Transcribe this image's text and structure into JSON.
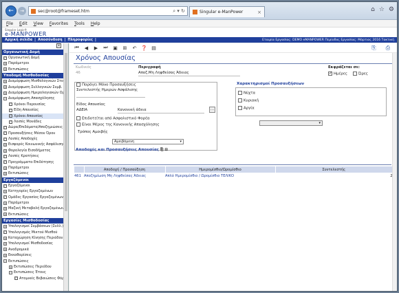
{
  "browser": {
    "address": "sec@root@frameset.htm",
    "tab_title": "Singular e-ManPower"
  },
  "menu": [
    "File",
    "Edit",
    "View",
    "Favorites",
    "Tools",
    "Help"
  ],
  "app": {
    "logo_top": "Singular Logic®",
    "logo": "e-MANPOWER",
    "nav_left": [
      "Αρχική σελίδα",
      "Αποσύνδεση",
      "Πληροφορίες"
    ],
    "nav_right": "Εταιρία Εργασίας: DEMO eMANPOWER   Περίοδος Εργασίας: Μάρτιος 2016 Τακτική"
  },
  "sidebar": {
    "sections": [
      {
        "title": "Οργανωτική Δομή",
        "items": [
          {
            "label": "Οργανωτική Δομή",
            "lvl": 0,
            "bx": "□"
          },
          {
            "label": "Παράμετροι",
            "lvl": 0,
            "bx": "+"
          },
          {
            "label": "Εκτυπώσεις",
            "lvl": 0,
            "bx": "+"
          }
        ]
      },
      {
        "title": "Υποδομή Μισθοδοσίας",
        "items": [
          {
            "label": "Διαμόρφωση Μισθολογικών Στοιχ.",
            "lvl": 0,
            "bx": "+"
          },
          {
            "label": "Διαμόρφωση Συλλογικών Συμβ.",
            "lvl": 0,
            "bx": "+"
          },
          {
            "label": "Διαμόρφωση Ημερολογιακών Ορ.",
            "lvl": 0,
            "bx": "+"
          },
          {
            "label": "Διαμόρφωση Απασχόλησης",
            "lvl": 0,
            "bx": "−"
          },
          {
            "label": "Χρόνοι Παρουσίας",
            "lvl": 1,
            "bx": "□"
          },
          {
            "label": "Είδη Απουσίας",
            "lvl": 1,
            "bx": "□"
          },
          {
            "label": "Χρόνοι Απουσίας",
            "lvl": 1,
            "bx": "□",
            "active": true
          },
          {
            "label": "Λοιπές Μονάδες",
            "lvl": 1,
            "bx": "□"
          },
          {
            "label": "Δώρα/Επιδόματα/Αποζημιώσεις",
            "lvl": 0,
            "bx": "□"
          },
          {
            "label": "Προσαυξήσεις Μέσου Όρου",
            "lvl": 0,
            "bx": "□"
          },
          {
            "label": "Λοιπές Αποδοχές",
            "lvl": 0,
            "bx": "□"
          },
          {
            "label": "Εισφορές Κοινωνικής Ασφάλισης",
            "lvl": 0,
            "bx": "+"
          },
          {
            "label": "Φορολογία Εισοδήματος",
            "lvl": 0,
            "bx": "+"
          },
          {
            "label": "Λοιπές Κρατήσεις",
            "lvl": 0,
            "bx": "□"
          },
          {
            "label": "Προγράμματα Επιδότησης",
            "lvl": 0,
            "bx": "□"
          },
          {
            "label": "Παράμετροι",
            "lvl": 0,
            "bx": "+"
          },
          {
            "label": "Εκτυπώσεις",
            "lvl": 0,
            "bx": "+"
          }
        ]
      },
      {
        "title": "Εργαζόμενοι",
        "items": [
          {
            "label": "Εργαζόμενοι",
            "lvl": 0,
            "bx": "□"
          },
          {
            "label": "Κατηγορίες Εργαζομένων",
            "lvl": 0,
            "bx": "+"
          },
          {
            "label": "Ομάδες Εργασίας Εργαζομένων",
            "lvl": 0,
            "bx": "□"
          },
          {
            "label": "Παράμετροι",
            "lvl": 0,
            "bx": "+"
          },
          {
            "label": "Μαζική Μεταβολή Εργαζομένων",
            "lvl": 0,
            "bx": "+"
          },
          {
            "label": "Εκτυπώσεις",
            "lvl": 0,
            "bx": "+"
          }
        ]
      },
      {
        "title": "Εργασίες Μισθοδοσίας",
        "items": [
          {
            "label": "Υπολογισμοί Συμβάσεων (Συλλ.)",
            "lvl": 0,
            "bx": "+"
          },
          {
            "label": "Υπολογισμός Μικτού Μισθού",
            "lvl": 0,
            "bx": "□"
          },
          {
            "label": "Καταχώρηση Κίνησης Περιόδου",
            "lvl": 0,
            "bx": "+"
          },
          {
            "label": "Υπολογισμοί Μισθοδοσίας",
            "lvl": 0,
            "bx": "+"
          },
          {
            "label": "Αναδρομικά",
            "lvl": 0,
            "bx": "+"
          },
          {
            "label": "Εκκαθαρίσεις",
            "lvl": 0,
            "bx": "+"
          },
          {
            "label": "Εκτυπώσεις",
            "lvl": 0,
            "bx": "−"
          },
          {
            "label": "Εκτυπώσεις Περιόδου",
            "lvl": 1,
            "bx": "+"
          },
          {
            "label": "Εκτυπώσεις Έτους",
            "lvl": 1,
            "bx": "−"
          },
          {
            "label": "Ατομικές Βεβαιώσεις Φόρου",
            "lvl": 2,
            "bx": "□"
          }
        ]
      }
    ]
  },
  "main": {
    "title": "Χρόνος Απουσίας",
    "code_label": "Κωδικός",
    "code_value": "46",
    "desc_label": "Περιγραφή",
    "desc_value": "Αποζ.Μη Ληφθείσας Άδειας",
    "express_label": "Εκφράζεται σε:",
    "express_days": "Ημέρες",
    "express_hours": "Ώρες",
    "produces_only_label": "Παράγει Μόνο Προσαυξήσεις",
    "insurance_days_label": "Συντελεστής Ημερών Ασφάλισης",
    "absence_type_label": "Είδος Απουσίας",
    "absence_type_code": "ΑΔΕΙΑ",
    "absence_type_name": "Κανονική άδεια",
    "subsidized_label": "Επιδοτείται από Ασφαλιστικό Φορέα",
    "regular_label": "Είναι Μέρος της Κανονικής Απασχόλησης",
    "pay_method_label": "Τρόπος Αμοιβής",
    "pay_method_value": "Αμειβόμενη",
    "characterizations_title": "Χαρακτηρισμοί Προσαυξήσεων",
    "night": "Νύχτα",
    "sunday": "Κυριακή",
    "holiday": "Αργία",
    "grid_title": "Αποδοχές και Προσαυξήσεις Απουσίας",
    "columns": [
      "Αποδοχή / Προσαύξηση",
      "Ημερομίσθιο/Ωρομίσθιο",
      "Συντελεστής"
    ],
    "rows": [
      {
        "code": "461",
        "name": "Αποζημίωση Μη Ληφθείσας Άδειας",
        "wage": "Απλό Ημερομίσθιο / Ωρομίσθιο ΤΕΛΙΚΟ",
        "coef": "2"
      }
    ]
  },
  "colors": {
    "accent": "#1f3f9c",
    "header_bg": "#cfd8ec"
  }
}
